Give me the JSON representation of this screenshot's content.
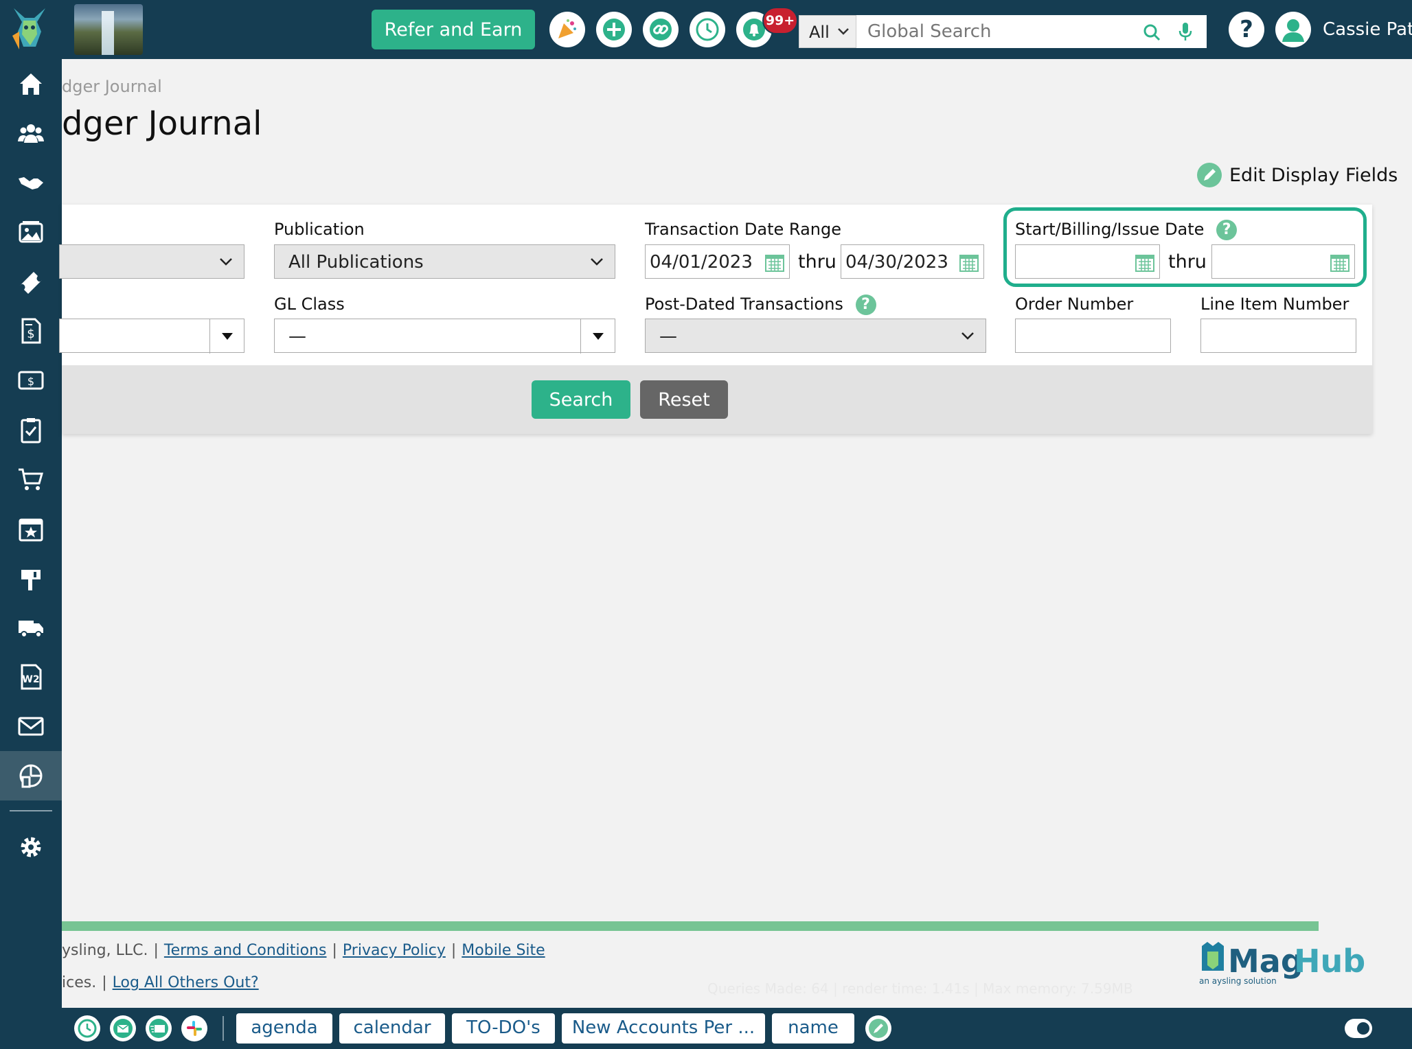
{
  "topbar": {
    "refer_label": "Refer and Earn",
    "notification_count": "99+",
    "search_scope": "All",
    "search_placeholder": "Global Search",
    "help_label": "?",
    "user_name": "Cassie Pata"
  },
  "sidebar": {
    "items": [
      {
        "icon": "home-icon"
      },
      {
        "icon": "contacts-icon"
      },
      {
        "icon": "handshake-icon"
      },
      {
        "icon": "media-icon"
      },
      {
        "icon": "ticket-icon"
      },
      {
        "icon": "invoice-icon"
      },
      {
        "icon": "finance-icon"
      },
      {
        "icon": "clipboard-check-icon"
      },
      {
        "icon": "cart-icon"
      },
      {
        "icon": "calendar-star-icon"
      },
      {
        "icon": "mailbox-icon"
      },
      {
        "icon": "truck-icon"
      },
      {
        "icon": "w2-form-icon"
      },
      {
        "icon": "envelope-icon"
      },
      {
        "icon": "reports-icon",
        "active": true
      },
      {
        "icon": "gear-icon"
      }
    ]
  },
  "page": {
    "breadcrumb": "dger Journal",
    "title": "dger Journal",
    "edit_fields_label": "Edit Display Fields"
  },
  "filters": {
    "publication_label": "Publication",
    "publication_value": "All Publications",
    "transaction_range_label": "Transaction Date Range",
    "transaction_start": "04/01/2023",
    "transaction_end": "04/30/2023",
    "thru_label": "thru",
    "start_billing_label": "Start/Billing/Issue Date",
    "start_billing_start": "",
    "start_billing_end": "",
    "gl_class_label": "GL Class",
    "gl_class_value": "—",
    "post_dated_label": "Post-Dated Transactions",
    "post_dated_value": "—",
    "order_number_label": "Order Number",
    "order_number_value": "",
    "line_item_label": "Line Item Number",
    "line_item_value": "",
    "search_label": "Search",
    "reset_label": "Reset"
  },
  "footer": {
    "company": "ysling, LLC.",
    "terms": "Terms and Conditions",
    "privacy": "Privacy Policy",
    "mobile": "Mobile Site",
    "prefix2": "ices.",
    "log_out_others": "Log All Others Out?",
    "perf": "Queries Made: 64 | render time: 1.41s | Max memory: 7.59MB",
    "brand_name": "MagHub",
    "brand_tagline": "an aysling solution"
  },
  "bottombar": {
    "tabs": [
      "agenda",
      "calendar",
      "TO-DO's",
      "New Accounts Per ...",
      "name"
    ]
  },
  "colors": {
    "navy": "#153d52",
    "accent_green": "#2db28a",
    "highlight_teal": "#1fae8c",
    "reset_gray": "#666666"
  }
}
